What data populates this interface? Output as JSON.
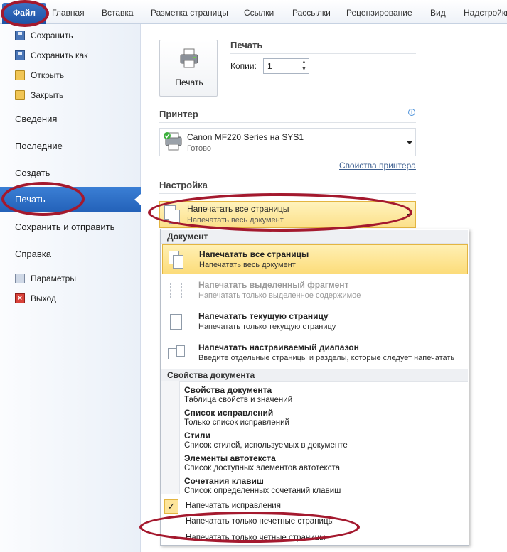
{
  "ribbon": {
    "file_tab": "Файл",
    "tabs": [
      "Главная",
      "Вставка",
      "Разметка страницы",
      "Ссылки",
      "Рассылки",
      "Рецензирование",
      "Вид",
      "Надстройки"
    ]
  },
  "nav": {
    "save": "Сохранить",
    "save_as": "Сохранить как",
    "open": "Открыть",
    "close": "Закрыть",
    "info": "Сведения",
    "recent": "Последние",
    "new": "Создать",
    "print": "Печать",
    "save_send": "Сохранить и отправить",
    "help": "Справка",
    "options": "Параметры",
    "exit": "Выход"
  },
  "print": {
    "button_label": "Печать",
    "section_title": "Печать",
    "copies_label": "Копии:",
    "copies_value": "1"
  },
  "printer": {
    "section_title": "Принтер",
    "name": "Canon MF220 Series на SYS1",
    "status": "Готово",
    "properties_link": "Свойства принтера"
  },
  "settings": {
    "section_title": "Настройка",
    "selected_title": "Напечатать все страницы",
    "selected_sub": "Напечатать весь документ"
  },
  "menu": {
    "section_document": "Документ",
    "items": [
      {
        "title": "Напечатать все страницы",
        "sub": "Напечатать весь документ"
      },
      {
        "title": "Напечатать выделенный фрагмент",
        "sub": "Напечатать только выделенное содержимое"
      },
      {
        "title": "Напечатать текущую страницу",
        "sub": "Напечатать только текущую страницу"
      },
      {
        "title": "Напечатать настраиваемый диапазон",
        "sub": "Введите отдельные страницы и разделы, которые следует напечатать"
      }
    ],
    "section_props": "Свойства документа",
    "props": [
      {
        "title": "Свойства документа",
        "sub": "Таблица свойств и значений"
      },
      {
        "title": "Список исправлений",
        "sub": "Только список исправлений"
      },
      {
        "title": "Стили",
        "sub": "Список стилей, используемых в документе"
      },
      {
        "title": "Элементы автотекста",
        "sub": "Список доступных элементов автотекста"
      },
      {
        "title": "Сочетания клавиш",
        "sub": "Список определенных сочетаний клавиш"
      }
    ],
    "options": {
      "print_markup": "Напечатать исправления",
      "odd_pages": "Напечатать только нечетные страницы",
      "even_pages": "Напечатать только четные страницы"
    },
    "check_mark": "✓"
  },
  "colors": {
    "accent": "#2361b8",
    "highlight": "#fce08a",
    "annotation": "#a4192e"
  }
}
